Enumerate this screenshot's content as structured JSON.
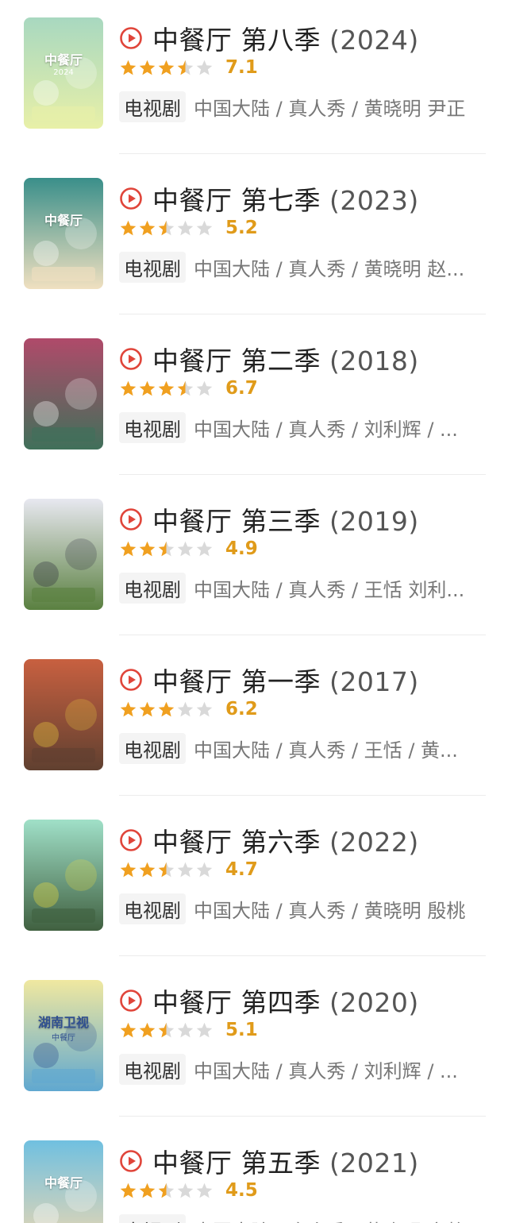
{
  "colors": {
    "play": "#e0453a",
    "star_on": "#f0a020",
    "star_off": "#d9d9d9",
    "score": "#e09b1a"
  },
  "items": [
    {
      "title": "中餐厅 第八季",
      "year": "(2024)",
      "rating": 3.5,
      "score": "7.1",
      "type": "电视剧",
      "meta": "中国大陆 / 真人秀 / 黄晓明 尹正",
      "poster": {
        "bg1": "#a8d8c0",
        "bg2": "#e8f0a8",
        "accent": "#ffffff",
        "text": "中餐厅",
        "sub": "2024"
      }
    },
    {
      "title": "中餐厅 第七季",
      "year": "(2023)",
      "rating": 2.5,
      "score": "5.2",
      "type": "电视剧",
      "meta": "中国大陆 / 真人秀 / 黄晓明 赵...",
      "poster": {
        "bg1": "#3a8f8a",
        "bg2": "#f0e0c0",
        "accent": "#ffffff",
        "text": "中餐厅",
        "sub": ""
      }
    },
    {
      "title": "中餐厅 第二季",
      "year": "(2018)",
      "rating": 3.5,
      "score": "6.7",
      "type": "电视剧",
      "meta": "中国大陆 / 真人秀 / 刘利辉 / ...",
      "poster": {
        "bg1": "#b04a6a",
        "bg2": "#40705a",
        "accent": "#ffffff",
        "text": "",
        "sub": ""
      }
    },
    {
      "title": "中餐厅 第三季",
      "year": "(2019)",
      "rating": 2.5,
      "score": "4.9",
      "type": "电视剧",
      "meta": "中国大陆 / 真人秀 / 王恬 刘利...",
      "poster": {
        "bg1": "#e8e8f0",
        "bg2": "#5a8040",
        "accent": "#303040",
        "text": "",
        "sub": ""
      }
    },
    {
      "title": "中餐厅 第一季",
      "year": "(2017)",
      "rating": 3,
      "score": "6.2",
      "type": "电视剧",
      "meta": "中国大陆 / 真人秀 / 王恬 / 黄...",
      "poster": {
        "bg1": "#c86040",
        "bg2": "#604030",
        "accent": "#f0d040",
        "text": "",
        "sub": ""
      }
    },
    {
      "title": "中餐厅 第六季",
      "year": "(2022)",
      "rating": 2.5,
      "score": "4.7",
      "type": "电视剧",
      "meta": "中国大陆 / 真人秀 / 黄晓明 殷桃",
      "poster": {
        "bg1": "#a0e0c8",
        "bg2": "#406040",
        "accent": "#f0e040",
        "text": "",
        "sub": ""
      }
    },
    {
      "title": "中餐厅 第四季",
      "year": "(2020)",
      "rating": 2.5,
      "score": "5.1",
      "type": "电视剧",
      "meta": "中国大陆 / 真人秀 / 刘利辉 / ...",
      "poster": {
        "bg1": "#f0e8a0",
        "bg2": "#60a8d0",
        "accent": "#305090",
        "text": "湖南卫视",
        "sub": "中餐厅"
      }
    },
    {
      "title": "中餐厅 第五季",
      "year": "(2021)",
      "rating": 2.5,
      "score": "4.5",
      "type": "电视剧",
      "meta": "中国大陆 / 真人秀 / 黄晓明 宋静",
      "poster": {
        "bg1": "#70c0e0",
        "bg2": "#f0d8b0",
        "accent": "#ffffff",
        "text": "中餐厅",
        "sub": ""
      }
    }
  ]
}
